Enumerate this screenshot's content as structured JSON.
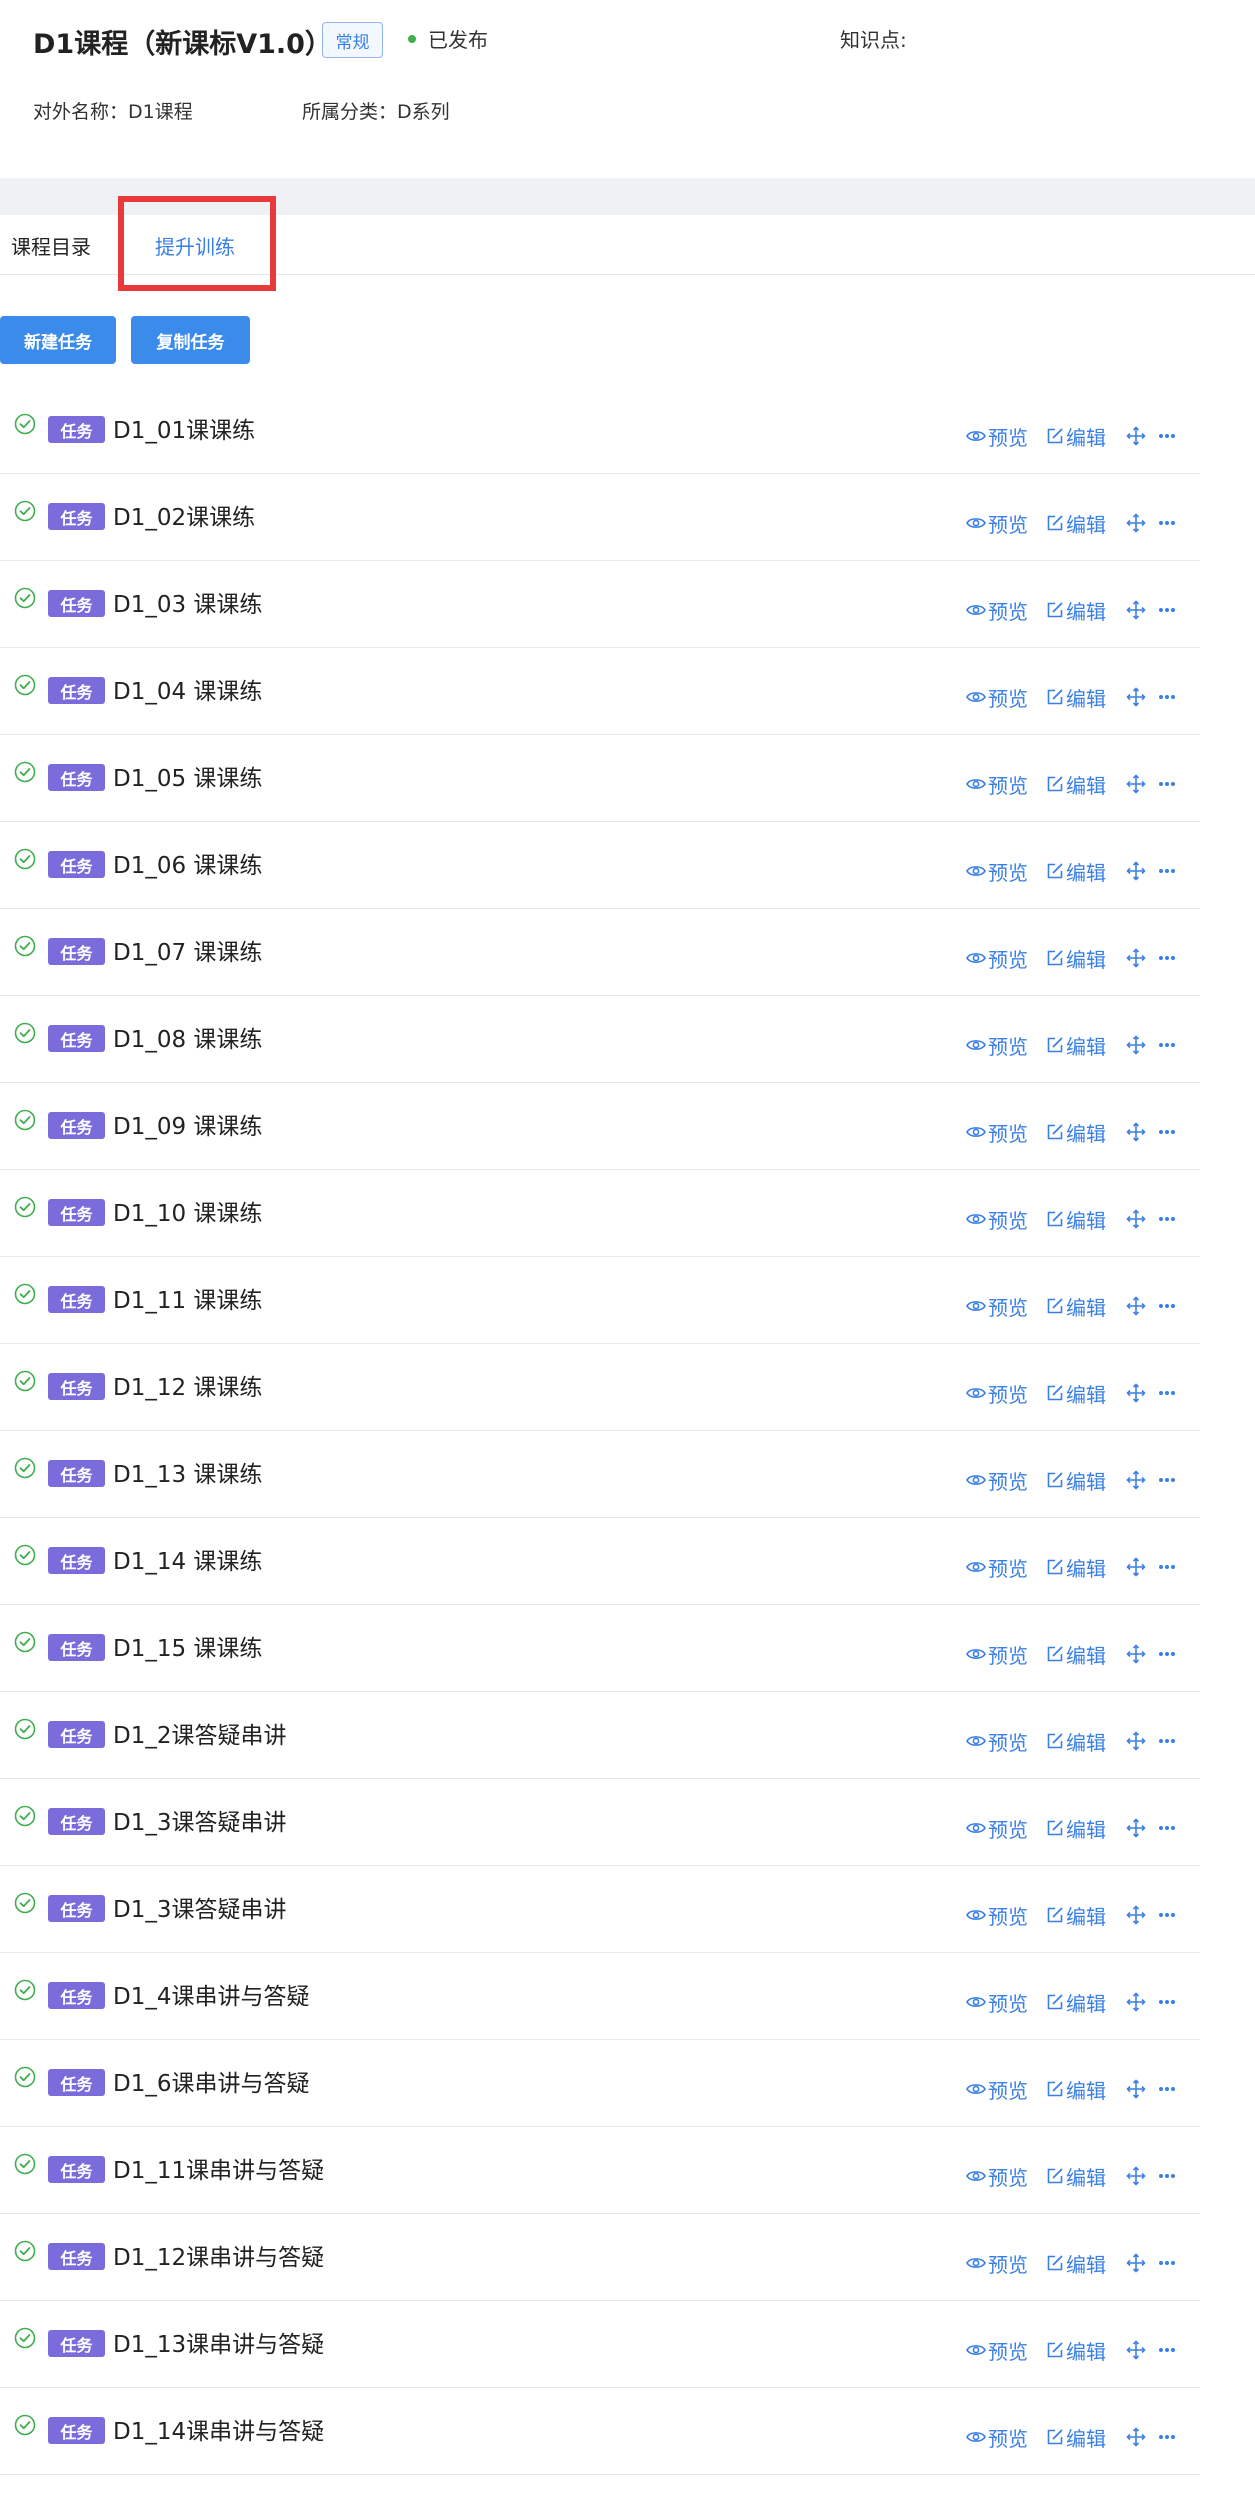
{
  "header": {
    "title": "D1课程（新课标V1.0）",
    "tag": "常规",
    "status": "已发布",
    "knowledge_label": "知识点:",
    "external_name": "对外名称：D1课程",
    "category": "所属分类：D系列"
  },
  "tabs": [
    {
      "label": "课程目录"
    },
    {
      "label": "提升训练"
    }
  ],
  "buttons": {
    "new_task": "新建任务",
    "copy_task": "复制任务"
  },
  "actions": {
    "preview": "预览",
    "edit": "编辑"
  },
  "colors": {
    "accent": "#3a7fe6",
    "button": "#3b8bea",
    "task_badge": "#7b6cdc",
    "status_ok": "#3fae4d",
    "highlight": "#e8393b"
  },
  "tasks": [
    {
      "badge": "任务",
      "name": "D1_01课课练"
    },
    {
      "badge": "任务",
      "name": "D1_02课课练"
    },
    {
      "badge": "任务",
      "name": "D1_03 课课练"
    },
    {
      "badge": "任务",
      "name": "D1_04 课课练"
    },
    {
      "badge": "任务",
      "name": "D1_05 课课练"
    },
    {
      "badge": "任务",
      "name": "D1_06 课课练"
    },
    {
      "badge": "任务",
      "name": "D1_07 课课练"
    },
    {
      "badge": "任务",
      "name": "D1_08 课课练"
    },
    {
      "badge": "任务",
      "name": "D1_09 课课练"
    },
    {
      "badge": "任务",
      "name": "D1_10 课课练"
    },
    {
      "badge": "任务",
      "name": "D1_11 课课练"
    },
    {
      "badge": "任务",
      "name": "D1_12 课课练"
    },
    {
      "badge": "任务",
      "name": "D1_13 课课练"
    },
    {
      "badge": "任务",
      "name": "D1_14 课课练"
    },
    {
      "badge": "任务",
      "name": "D1_15 课课练"
    },
    {
      "badge": "任务",
      "name": "D1_2课答疑串讲"
    },
    {
      "badge": "任务",
      "name": "D1_3课答疑串讲"
    },
    {
      "badge": "任务",
      "name": "D1_3课答疑串讲"
    },
    {
      "badge": "任务",
      "name": "D1_4课串讲与答疑"
    },
    {
      "badge": "任务",
      "name": "D1_6课串讲与答疑"
    },
    {
      "badge": "任务",
      "name": "D1_11课串讲与答疑"
    },
    {
      "badge": "任务",
      "name": "D1_12课串讲与答疑"
    },
    {
      "badge": "任务",
      "name": "D1_13课串讲与答疑"
    },
    {
      "badge": "任务",
      "name": "D1_14课串讲与答疑"
    }
  ]
}
